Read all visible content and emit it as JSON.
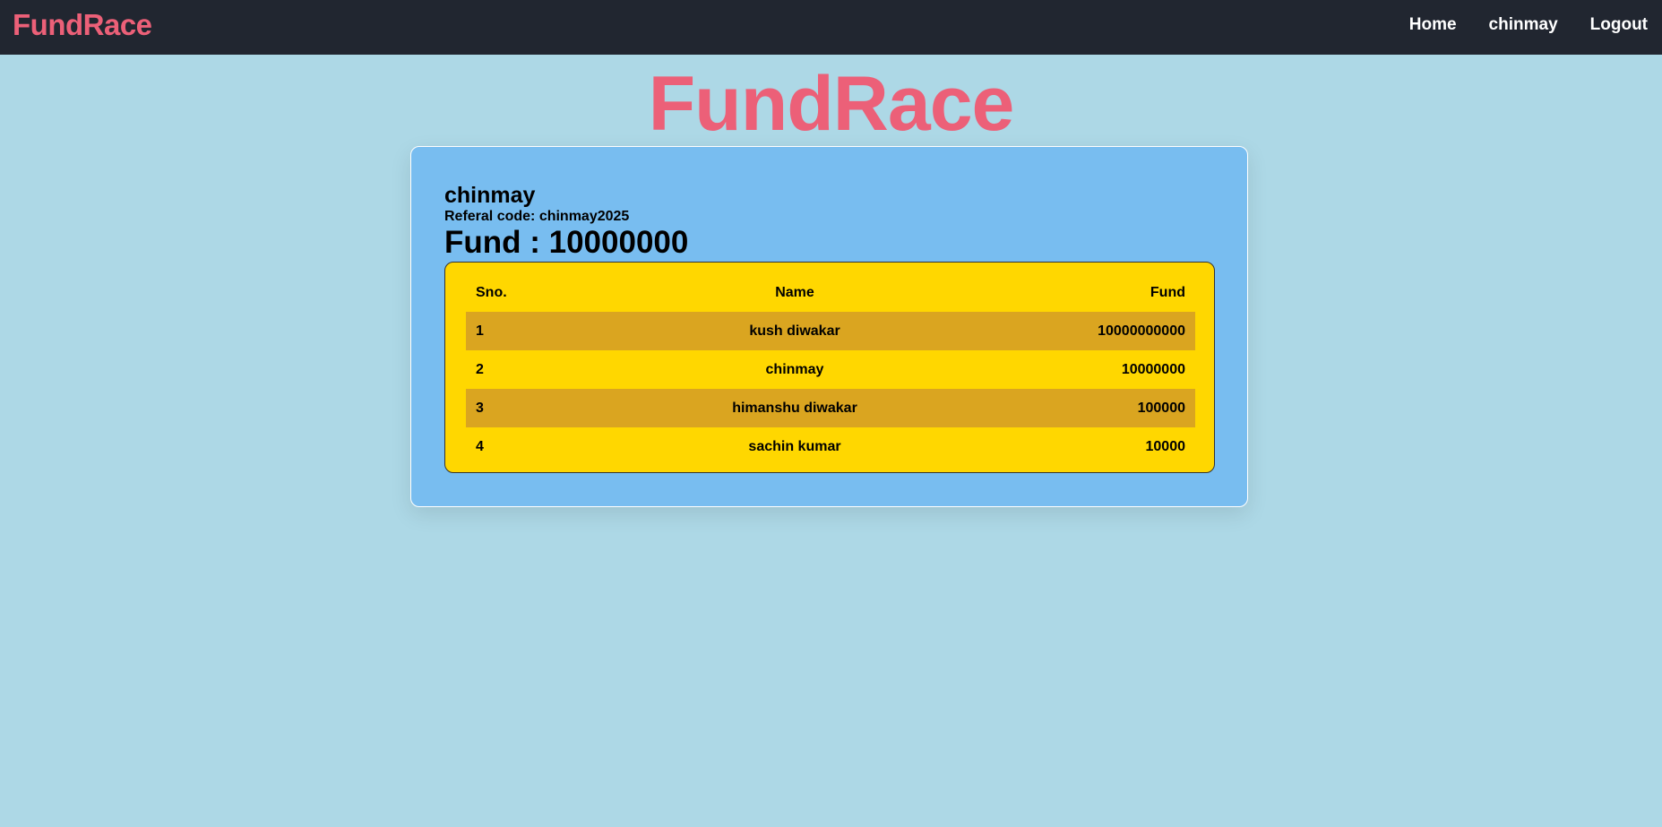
{
  "navbar": {
    "brand": "FundRace",
    "links": [
      "Home",
      "chinmay",
      "Logout"
    ]
  },
  "hero": {
    "title": "FundRace"
  },
  "profile": {
    "name": "chinmay",
    "referral_label": "Referal code: ",
    "referral_code": "chinmay2025",
    "fund_label": "Fund : ",
    "fund_value": "10000000"
  },
  "leaderboard": {
    "columns": [
      "Sno.",
      "Name",
      "Fund"
    ],
    "rows": [
      {
        "sno": "1",
        "name": "kush diwakar",
        "fund": "10000000000"
      },
      {
        "sno": "2",
        "name": "chinmay",
        "fund": "10000000"
      },
      {
        "sno": "3",
        "name": "himanshu diwakar",
        "fund": "100000"
      },
      {
        "sno": "4",
        "name": "sachin kumar",
        "fund": "10000"
      }
    ]
  },
  "colors": {
    "navbar_bg": "#212630",
    "brand": "#ec6078",
    "page_bg": "#add8e6",
    "card_bg": "#78bdf0",
    "table_bg": "#ffd700",
    "row_alt": "#daa520"
  }
}
